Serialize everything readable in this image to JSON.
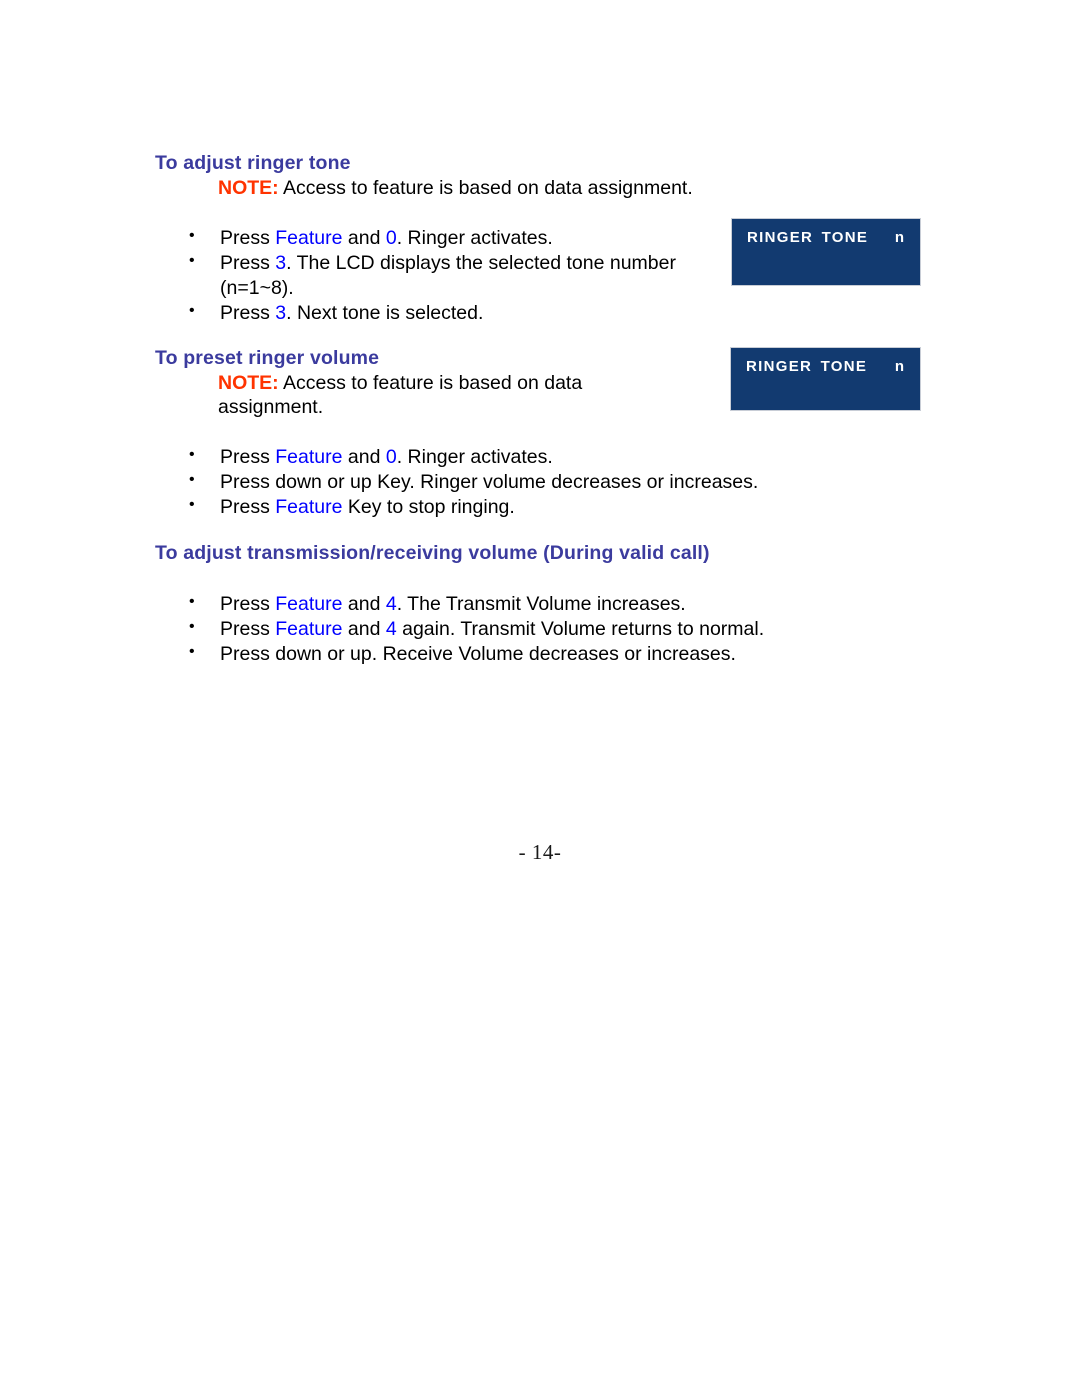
{
  "document": {
    "page_number": "- 14-",
    "heading_color": "#3b3b9e",
    "note_color": "#ff3300",
    "keyword_color": "#0000ff",
    "lcd_background": "#123a70"
  },
  "sections": [
    {
      "heading": "To adjust ringer tone",
      "note_label": "NOTE:",
      "note_text": " Access to feature is based on data assignment.",
      "bullets": [
        {
          "parts": [
            {
              "text": "Press ",
              "color": "black"
            },
            {
              "text": "Feature",
              "color": "blue"
            },
            {
              "text": " and ",
              "color": "black"
            },
            {
              "text": "0",
              "color": "blue"
            },
            {
              "text": ". Ringer activates.",
              "color": "black"
            }
          ]
        },
        {
          "parts": [
            {
              "text": "Press ",
              "color": "black"
            },
            {
              "text": "3",
              "color": "blue"
            },
            {
              "text": ". The LCD displays the selected tone number (n=1~8).",
              "color": "black"
            }
          ]
        },
        {
          "parts": [
            {
              "text": "Press ",
              "color": "black"
            },
            {
              "text": "3",
              "color": "blue"
            },
            {
              "text": ". Next tone is selected.",
              "color": "black"
            }
          ]
        }
      ]
    },
    {
      "heading": "To preset ringer volume",
      "note_label": "NOTE:",
      "note_text": " Access to feature is based on data assignment.",
      "bullets": [
        {
          "parts": [
            {
              "text": "Press ",
              "color": "black"
            },
            {
              "text": "Feature",
              "color": "blue"
            },
            {
              "text": " and ",
              "color": "black"
            },
            {
              "text": "0",
              "color": "blue"
            },
            {
              "text": ". Ringer activates.",
              "color": "black"
            }
          ]
        },
        {
          "parts": [
            {
              "text": "Press down or up Key.  Ringer volume decreases or increases.",
              "color": "black"
            }
          ]
        },
        {
          "parts": [
            {
              "text": "Press ",
              "color": "black"
            },
            {
              "text": "Feature",
              "color": "blue"
            },
            {
              "text": " Key to stop ringing.",
              "color": "black"
            }
          ]
        }
      ]
    },
    {
      "heading": "To adjust transmission/receiving volume (During valid call)",
      "bullets": [
        {
          "parts": [
            {
              "text": "Press ",
              "color": "black"
            },
            {
              "text": "Feature",
              "color": "blue"
            },
            {
              "text": " and ",
              "color": "black"
            },
            {
              "text": "4",
              "color": "blue"
            },
            {
              "text": ". The Transmit Volume increases.",
              "color": "black"
            }
          ]
        },
        {
          "parts": [
            {
              "text": "Press ",
              "color": "black"
            },
            {
              "text": "Feature",
              "color": "blue"
            },
            {
              "text": " and ",
              "color": "black"
            },
            {
              "text": "4",
              "color": "blue"
            },
            {
              "text": " again. Transmit Volume returns to normal.",
              "color": "black"
            }
          ]
        },
        {
          "parts": [
            {
              "text": "Press down or up. Receive Volume decreases or increases.",
              "color": "black"
            }
          ]
        }
      ]
    }
  ],
  "lcd_displays": [
    {
      "label": "RINGER TONE",
      "value": "n"
    },
    {
      "label": "RINGER TONE",
      "value": "n"
    }
  ]
}
